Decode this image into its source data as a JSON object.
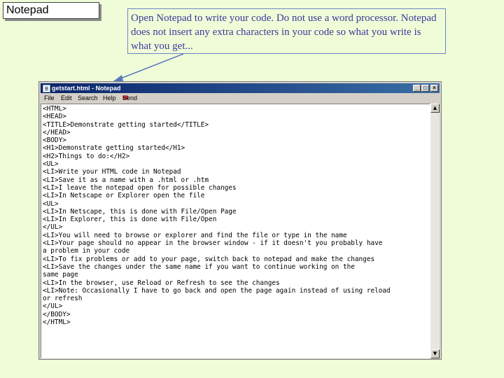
{
  "slide": {
    "title": "Notepad",
    "callout": "Open Notepad to write your code.  Do not use a word processor. Notepad does not insert any extra characters in your code so what you write is what you get..."
  },
  "window": {
    "title": "getstart.html - Notepad",
    "controls": {
      "minimize": "_",
      "maximize": "□",
      "close": "×"
    },
    "menu": {
      "file": "File",
      "edit": "Edit",
      "search": "Search",
      "help": "Help",
      "send": "Send"
    },
    "scroll": {
      "up": "▲",
      "down": "▼"
    },
    "content": [
      "<HTML>",
      "<HEAD>",
      "<TITLE>Demonstrate getting started</TITLE>",
      "</HEAD>",
      "<BODY>",
      "<H1>Demonstrate getting started</H1>",
      "<H2>Things to do:</H2>",
      "<UL>",
      "<LI>Write your HTML code in Notepad",
      "<LI>Save it as a name with a .html or .htm",
      "<LI>I leave the notepad open for possible changes",
      "<LI>In Netscape or Explorer open the file",
      "<UL>",
      "<LI>In Netscape, this is done with File/Open Page",
      "<LI>In Explorer, this is done with File/Open",
      "</UL>",
      "<LI>You will need to browse or explorer and find the file or type in the name",
      "<LI>Your page should no appear in the browser window - if it doesn't you probably have",
      "a problem in your code",
      "<LI>To fix problems or add to your page, switch back to notepad and make the changes",
      "<LI>Save the changes under the same name if you want to continue working on the",
      "same page",
      "<LI>In the browser, use Reload or Refresh to see the changes",
      "<LI>Note: Occasionally I have to go back and open the page again instead of using reload",
      "or refresh",
      "</UL>",
      "</BODY>",
      "</HTML>"
    ]
  }
}
